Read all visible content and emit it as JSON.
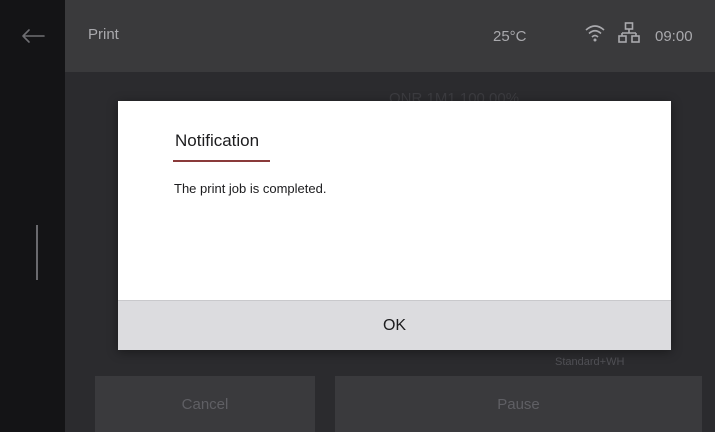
{
  "header": {
    "title": "Print",
    "temperature": "25°C",
    "time": "09:00"
  },
  "background": {
    "faded_heading": "ONR 1M1 100.00%",
    "faded_label": "Standard+WH",
    "cancel_label": "Cancel",
    "pause_label": "Pause"
  },
  "dialog": {
    "title": "Notification",
    "message": "The print job is completed.",
    "ok_label": "OK"
  },
  "icons": {
    "back": "arrow-left",
    "wifi": "wifi",
    "network": "network"
  },
  "colors": {
    "header_bg": "#3a3a3c",
    "dialog_bg": "#ffffff",
    "ok_bg": "#dcdcdf",
    "title_accent": "#8a3a3a"
  }
}
